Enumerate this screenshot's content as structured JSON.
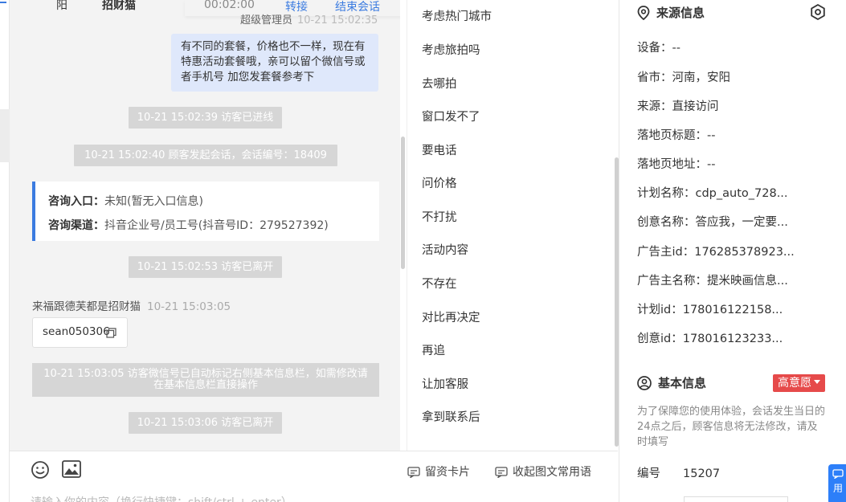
{
  "top_bar": {
    "col_province": "阳",
    "col_name": "招财猫",
    "col_duration": "00:02:00",
    "transfer_label": "转接",
    "end_session_label": "结束会话"
  },
  "chat": {
    "agent_sender": "超级管理员",
    "agent_time": "10-21 15:02:35",
    "agent_message": "有不同的套餐，价格也不一样，现在有特惠活动套餐哦，亲可以留个微信号或者手机号 加您发套餐参考下",
    "sys_1": "10-21 15:02:39 访客已进线",
    "sys_2": "10-21 15:02:40 顾客发起会话，会话编号：18409",
    "consult_entry_label": "咨询入口：",
    "consult_entry_value": "未知(暂无入口信息)",
    "consult_channel_label": "咨询渠道：",
    "consult_channel_value": "抖音企业号/员工号(抖音号ID：279527392)",
    "sys_3": "10-21 15:02:53 访客已离开",
    "visitor_name": "来福跟德芙都是招财猫",
    "visitor_time": "10-21 15:03:05",
    "wechat_card": "sean050306",
    "sys_4": "10-21 15:03:05 访客微信号已自动标记右侧基本信息栏，如需修改请在基本信息栏直接操作",
    "sys_5": "10-21 15:03:06 访客已离开"
  },
  "input": {
    "leave_card_label": "留资卡片",
    "collapse_phrases_label": "收起图文常用语",
    "placeholder": "请输入你的内容（换行快捷键：shift/ctrl + enter）"
  },
  "quick_replies": [
    "考虑热门城市",
    "考虑旅拍吗",
    "去哪拍",
    "窗口发不了",
    "要电话",
    "问价格",
    "不打扰",
    "活动内容",
    "不存在",
    "对比再决定",
    "再追",
    "让加客服",
    "拿到联系后"
  ],
  "source_info": {
    "title": "来源信息",
    "rows": [
      "设备：--",
      "省市：河南，安阳",
      "来源：直接访问",
      "落地页标题：--",
      "落地页地址：--",
      "计划名称：cdp_auto_728...",
      "创意名称：答应我，一定要...",
      "广告主id：176285378923...",
      "广告主名称：提米映画信息...",
      "计划id：178016122158...",
      "创意id：178016123233..."
    ]
  },
  "basic_info": {
    "title": "基本信息",
    "intent_tag": "高意愿",
    "hint": "为了保障您的使用体验，会话发生当日的24点之后，顾客信息将无法修改，请及时填写",
    "id_label": "编号",
    "id_value": "15207",
    "float_label": "用"
  },
  "colors": {
    "accent": "#3b7be0",
    "tag_red": "#e64a4a",
    "system_gray": "#d6d6d6",
    "agent_bubble": "#dfe8fb"
  }
}
